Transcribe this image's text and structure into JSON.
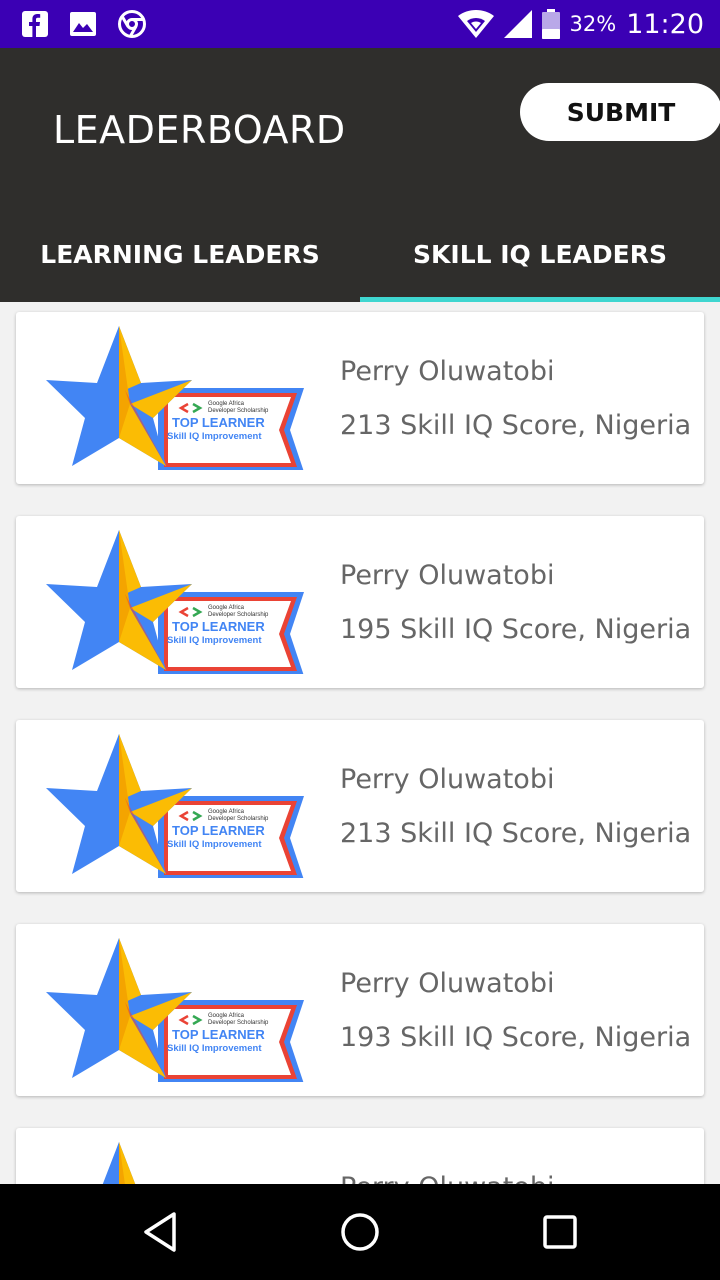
{
  "status_bar": {
    "icons_left": [
      "facebook-icon",
      "gallery-icon",
      "chrome-icon"
    ],
    "icons_right": [
      "wifi-icon",
      "signal-icon",
      "battery-icon"
    ],
    "battery": "32%",
    "time": "11:20"
  },
  "app_bar": {
    "title": "LEADERBOARD",
    "submit_label": "SUBMIT"
  },
  "tabs": [
    {
      "label": "LEARNING LEADERS",
      "selected": false
    },
    {
      "label": "SKILL IQ LEADERS",
      "selected": true
    }
  ],
  "badge": {
    "line1": "Google Africa",
    "line2": "Developer Scholarship",
    "title": "TOP LEARNER",
    "subtitle": "Skill IQ Improvement"
  },
  "leaders": [
    {
      "name": "Perry Oluwatobi",
      "score": "213 Skill IQ Score, Nigeria"
    },
    {
      "name": "Perry Oluwatobi",
      "score": "195 Skill IQ Score, Nigeria"
    },
    {
      "name": "Perry Oluwatobi",
      "score": "213 Skill IQ Score, Nigeria"
    },
    {
      "name": "Perry Oluwatobi",
      "score": "193 Skill IQ Score, Nigeria"
    },
    {
      "name": "Perry Oluwatobi",
      "score": ""
    }
  ],
  "colors": {
    "status_bar": "#3b00b4",
    "app_bar": "#2f2e2c",
    "tab_indicator": "#3fd6d0",
    "star_blue": "#4285f4",
    "star_yellow": "#fbbc04",
    "badge_red": "#ea4335"
  },
  "nav_bar": {
    "icons": [
      "back-icon",
      "home-icon",
      "recents-icon"
    ]
  }
}
